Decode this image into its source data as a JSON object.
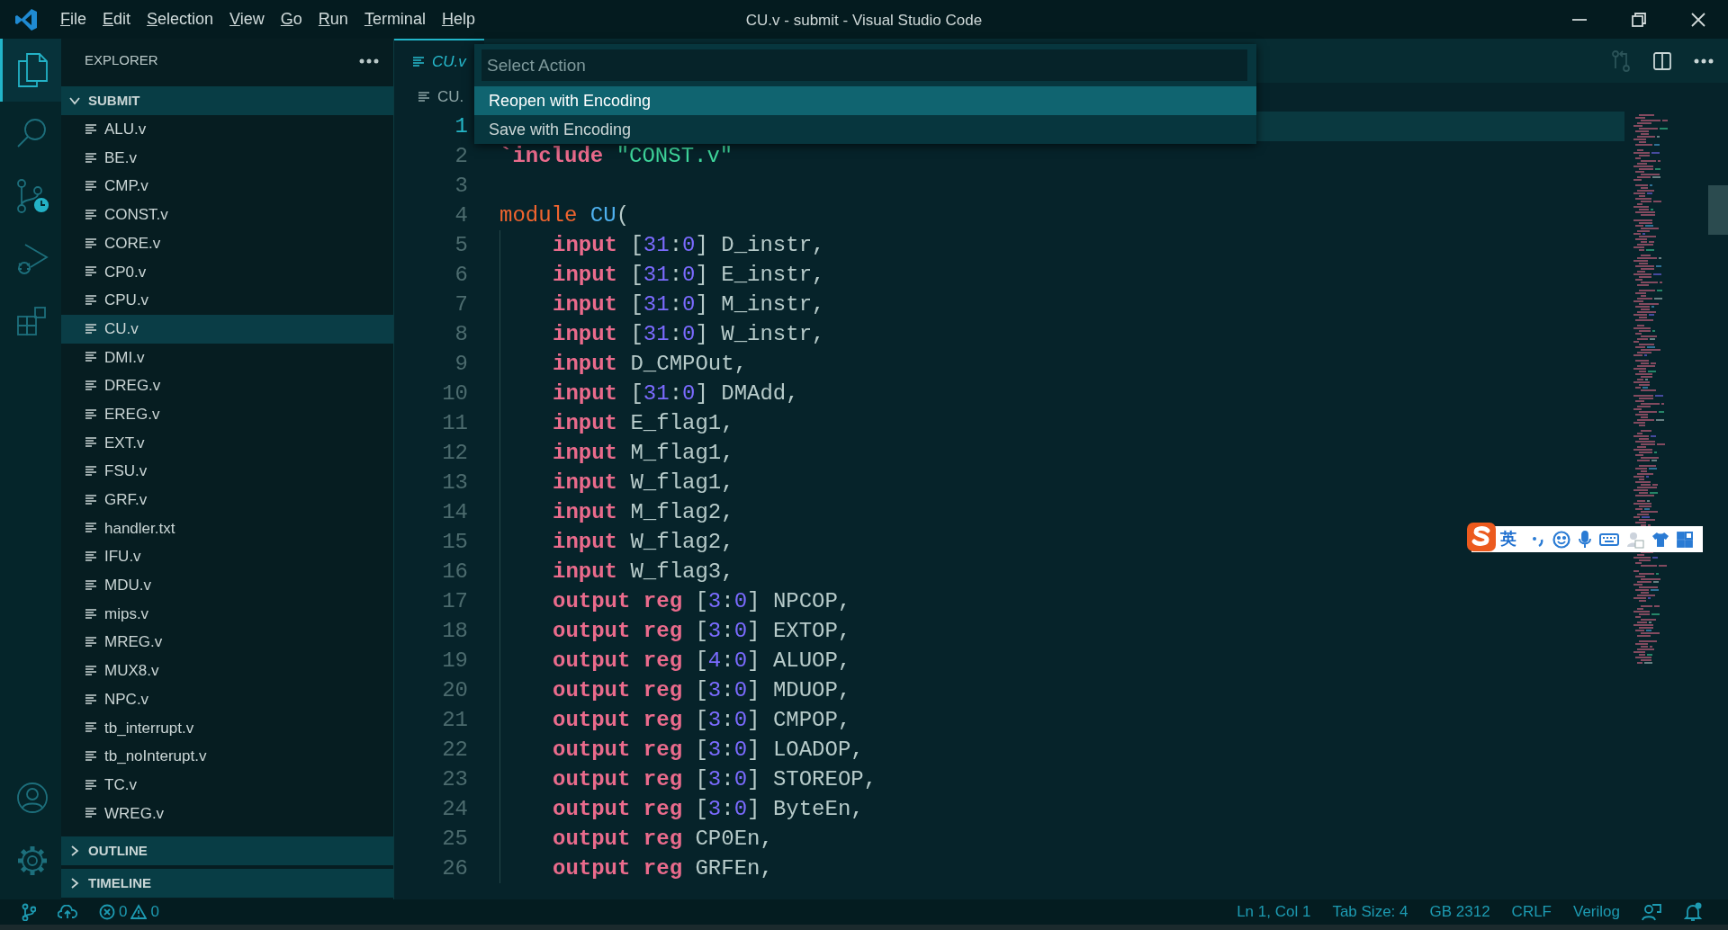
{
  "window": {
    "title": "CU.v - submit - Visual Studio Code"
  },
  "menu": [
    {
      "label": "File"
    },
    {
      "label": "Edit"
    },
    {
      "label": "Selection"
    },
    {
      "label": "View"
    },
    {
      "label": "Go"
    },
    {
      "label": "Run"
    },
    {
      "label": "Terminal"
    },
    {
      "label": "Help"
    }
  ],
  "activity_bar": [
    {
      "kind": "explorer",
      "selected": true
    },
    {
      "kind": "search",
      "selected": false
    },
    {
      "kind": "source-control",
      "selected": false
    },
    {
      "kind": "run",
      "selected": false
    },
    {
      "kind": "extensions",
      "selected": false
    }
  ],
  "activity_bar_bottom": [
    {
      "kind": "account"
    },
    {
      "kind": "settings"
    }
  ],
  "sidebar": {
    "title": "EXPLORER",
    "sections": [
      {
        "label": "SUBMIT",
        "expanded": true,
        "items": [
          {
            "label": "ALU.v",
            "selected": false
          },
          {
            "label": "BE.v",
            "selected": false
          },
          {
            "label": "CMP.v",
            "selected": false
          },
          {
            "label": "CONST.v",
            "selected": false
          },
          {
            "label": "CORE.v",
            "selected": false
          },
          {
            "label": "CP0.v",
            "selected": false
          },
          {
            "label": "CPU.v",
            "selected": false
          },
          {
            "label": "CU.v",
            "selected": true
          },
          {
            "label": "DMI.v",
            "selected": false
          },
          {
            "label": "DREG.v",
            "selected": false
          },
          {
            "label": "EREG.v",
            "selected": false
          },
          {
            "label": "EXT.v",
            "selected": false
          },
          {
            "label": "FSU.v",
            "selected": false
          },
          {
            "label": "GRF.v",
            "selected": false
          },
          {
            "label": "handler.txt",
            "selected": false
          },
          {
            "label": "IFU.v",
            "selected": false
          },
          {
            "label": "MDU.v",
            "selected": false
          },
          {
            "label": "mips.v",
            "selected": false
          },
          {
            "label": "MREG.v",
            "selected": false
          },
          {
            "label": "MUX8.v",
            "selected": false
          },
          {
            "label": "NPC.v",
            "selected": false
          },
          {
            "label": "tb_interrupt.v",
            "selected": false
          },
          {
            "label": "tb_noInterupt.v",
            "selected": false
          },
          {
            "label": "TC.v",
            "selected": false
          },
          {
            "label": "WREG.v",
            "selected": false
          }
        ]
      },
      {
        "label": "OUTLINE",
        "expanded": false
      },
      {
        "label": "TIMELINE",
        "expanded": false
      }
    ]
  },
  "editor": {
    "tabs": [
      {
        "label": "CU.v",
        "selected": true,
        "preview": true
      }
    ],
    "breadcrumb": "CU.",
    "lines": [
      {
        "n": "1",
        "current": true,
        "indented": false
      },
      {
        "n": "2",
        "current": false,
        "indented": false,
        "tokens": [
          {
            "kind": "keyword",
            "text": "`include"
          },
          {
            "kind": "string",
            "text": "\"CONST.v\"",
            "gap": true
          }
        ]
      },
      {
        "n": "3",
        "current": false,
        "indented": false
      },
      {
        "n": "4",
        "current": false,
        "indented": false,
        "tokens": [
          {
            "kind": "module",
            "text": "module"
          },
          {
            "kind": "name",
            "text": "CU",
            "gap": true
          },
          {
            "kind": "plain",
            "text": "("
          }
        ]
      },
      {
        "n": "5",
        "current": false,
        "indented": true,
        "tokens": [
          {
            "kind": "keyword",
            "text": "input"
          },
          {
            "kind": "plain",
            "text": "[",
            "gap": true
          },
          {
            "kind": "number",
            "text": "31"
          },
          {
            "kind": "plain",
            "text": ":"
          },
          {
            "kind": "number",
            "text": "0"
          },
          {
            "kind": "plain",
            "text": "] D_instr,"
          }
        ]
      },
      {
        "n": "6",
        "current": false,
        "indented": true,
        "tokens": [
          {
            "kind": "keyword",
            "text": "input"
          },
          {
            "kind": "plain",
            "text": "[",
            "gap": true
          },
          {
            "kind": "number",
            "text": "31"
          },
          {
            "kind": "plain",
            "text": ":"
          },
          {
            "kind": "number",
            "text": "0"
          },
          {
            "kind": "plain",
            "text": "] E_instr,"
          }
        ]
      },
      {
        "n": "7",
        "current": false,
        "indented": true,
        "tokens": [
          {
            "kind": "keyword",
            "text": "input"
          },
          {
            "kind": "plain",
            "text": "[",
            "gap": true
          },
          {
            "kind": "number",
            "text": "31"
          },
          {
            "kind": "plain",
            "text": ":"
          },
          {
            "kind": "number",
            "text": "0"
          },
          {
            "kind": "plain",
            "text": "] M_instr,"
          }
        ]
      },
      {
        "n": "8",
        "current": false,
        "indented": true,
        "tokens": [
          {
            "kind": "keyword",
            "text": "input"
          },
          {
            "kind": "plain",
            "text": "[",
            "gap": true
          },
          {
            "kind": "number",
            "text": "31"
          },
          {
            "kind": "plain",
            "text": ":"
          },
          {
            "kind": "number",
            "text": "0"
          },
          {
            "kind": "plain",
            "text": "] W_instr,"
          }
        ]
      },
      {
        "n": "9",
        "current": false,
        "indented": true,
        "tokens": [
          {
            "kind": "keyword",
            "text": "input"
          },
          {
            "kind": "plain",
            "text": "D_CMPOut,",
            "gap": true
          }
        ]
      },
      {
        "n": "10",
        "current": false,
        "indented": true,
        "tokens": [
          {
            "kind": "keyword",
            "text": "input"
          },
          {
            "kind": "plain",
            "text": "[",
            "gap": true
          },
          {
            "kind": "number",
            "text": "31"
          },
          {
            "kind": "plain",
            "text": ":"
          },
          {
            "kind": "number",
            "text": "0"
          },
          {
            "kind": "plain",
            "text": "] DMAdd,"
          }
        ]
      },
      {
        "n": "11",
        "current": false,
        "indented": true,
        "tokens": [
          {
            "kind": "keyword",
            "text": "input"
          },
          {
            "kind": "plain",
            "text": "E_flag1,",
            "gap": true
          }
        ]
      },
      {
        "n": "12",
        "current": false,
        "indented": true,
        "tokens": [
          {
            "kind": "keyword",
            "text": "input"
          },
          {
            "kind": "plain",
            "text": "M_flag1,",
            "gap": true
          }
        ]
      },
      {
        "n": "13",
        "current": false,
        "indented": true,
        "tokens": [
          {
            "kind": "keyword",
            "text": "input"
          },
          {
            "kind": "plain",
            "text": "W_flag1,",
            "gap": true
          }
        ]
      },
      {
        "n": "14",
        "current": false,
        "indented": true,
        "tokens": [
          {
            "kind": "keyword",
            "text": "input"
          },
          {
            "kind": "plain",
            "text": "M_flag2,",
            "gap": true
          }
        ]
      },
      {
        "n": "15",
        "current": false,
        "indented": true,
        "tokens": [
          {
            "kind": "keyword",
            "text": "input"
          },
          {
            "kind": "plain",
            "text": "W_flag2,",
            "gap": true
          }
        ]
      },
      {
        "n": "16",
        "current": false,
        "indented": true,
        "tokens": [
          {
            "kind": "keyword",
            "text": "input"
          },
          {
            "kind": "plain",
            "text": "W_flag3,",
            "gap": true
          }
        ]
      },
      {
        "n": "17",
        "current": false,
        "indented": true,
        "tokens": [
          {
            "kind": "keyword",
            "text": "output"
          },
          {
            "kind": "keyword",
            "text": "reg",
            "gap": true
          },
          {
            "kind": "plain",
            "text": "[",
            "gap": true
          },
          {
            "kind": "number",
            "text": "3"
          },
          {
            "kind": "plain",
            "text": ":"
          },
          {
            "kind": "number",
            "text": "0"
          },
          {
            "kind": "plain",
            "text": "] NPCOP,"
          }
        ]
      },
      {
        "n": "18",
        "current": false,
        "indented": true,
        "tokens": [
          {
            "kind": "keyword",
            "text": "output"
          },
          {
            "kind": "keyword",
            "text": "reg",
            "gap": true
          },
          {
            "kind": "plain",
            "text": "[",
            "gap": true
          },
          {
            "kind": "number",
            "text": "3"
          },
          {
            "kind": "plain",
            "text": ":"
          },
          {
            "kind": "number",
            "text": "0"
          },
          {
            "kind": "plain",
            "text": "] EXTOP,"
          }
        ]
      },
      {
        "n": "19",
        "current": false,
        "indented": true,
        "tokens": [
          {
            "kind": "keyword",
            "text": "output"
          },
          {
            "kind": "keyword",
            "text": "reg",
            "gap": true
          },
          {
            "kind": "plain",
            "text": "[",
            "gap": true
          },
          {
            "kind": "number",
            "text": "4"
          },
          {
            "kind": "plain",
            "text": ":"
          },
          {
            "kind": "number",
            "text": "0"
          },
          {
            "kind": "plain",
            "text": "] ALUOP,"
          }
        ]
      },
      {
        "n": "20",
        "current": false,
        "indented": true,
        "tokens": [
          {
            "kind": "keyword",
            "text": "output"
          },
          {
            "kind": "keyword",
            "text": "reg",
            "gap": true
          },
          {
            "kind": "plain",
            "text": "[",
            "gap": true
          },
          {
            "kind": "number",
            "text": "3"
          },
          {
            "kind": "plain",
            "text": ":"
          },
          {
            "kind": "number",
            "text": "0"
          },
          {
            "kind": "plain",
            "text": "] MDUOP,"
          }
        ]
      },
      {
        "n": "21",
        "current": false,
        "indented": true,
        "tokens": [
          {
            "kind": "keyword",
            "text": "output"
          },
          {
            "kind": "keyword",
            "text": "reg",
            "gap": true
          },
          {
            "kind": "plain",
            "text": "[",
            "gap": true
          },
          {
            "kind": "number",
            "text": "3"
          },
          {
            "kind": "plain",
            "text": ":"
          },
          {
            "kind": "number",
            "text": "0"
          },
          {
            "kind": "plain",
            "text": "] CMPOP,"
          }
        ]
      },
      {
        "n": "22",
        "current": false,
        "indented": true,
        "tokens": [
          {
            "kind": "keyword",
            "text": "output"
          },
          {
            "kind": "keyword",
            "text": "reg",
            "gap": true
          },
          {
            "kind": "plain",
            "text": "[",
            "gap": true
          },
          {
            "kind": "number",
            "text": "3"
          },
          {
            "kind": "plain",
            "text": ":"
          },
          {
            "kind": "number",
            "text": "0"
          },
          {
            "kind": "plain",
            "text": "] LOADOP,"
          }
        ]
      },
      {
        "n": "23",
        "current": false,
        "indented": true,
        "tokens": [
          {
            "kind": "keyword",
            "text": "output"
          },
          {
            "kind": "keyword",
            "text": "reg",
            "gap": true
          },
          {
            "kind": "plain",
            "text": "[",
            "gap": true
          },
          {
            "kind": "number",
            "text": "3"
          },
          {
            "kind": "plain",
            "text": ":"
          },
          {
            "kind": "number",
            "text": "0"
          },
          {
            "kind": "plain",
            "text": "] STOREOP,"
          }
        ]
      },
      {
        "n": "24",
        "current": false,
        "indented": true,
        "tokens": [
          {
            "kind": "keyword",
            "text": "output"
          },
          {
            "kind": "keyword",
            "text": "reg",
            "gap": true
          },
          {
            "kind": "plain",
            "text": "[",
            "gap": true
          },
          {
            "kind": "number",
            "text": "3"
          },
          {
            "kind": "plain",
            "text": ":"
          },
          {
            "kind": "number",
            "text": "0"
          },
          {
            "kind": "plain",
            "text": "] ByteEn,"
          }
        ]
      },
      {
        "n": "25",
        "current": false,
        "indented": true,
        "tokens": [
          {
            "kind": "keyword",
            "text": "output"
          },
          {
            "kind": "keyword",
            "text": "reg",
            "gap": true
          },
          {
            "kind": "plain",
            "text": "CP0En,",
            "gap": true
          }
        ]
      },
      {
        "n": "26",
        "current": false,
        "indented": true,
        "tokens": [
          {
            "kind": "keyword",
            "text": "output"
          },
          {
            "kind": "keyword",
            "text": "reg",
            "gap": true
          },
          {
            "kind": "plain",
            "text": "GRFEn,",
            "gap": true
          }
        ]
      }
    ]
  },
  "quick_pick": {
    "placeholder": "Select Action",
    "items": [
      {
        "label": "Reopen with Encoding",
        "selected": true
      },
      {
        "label": "Save with Encoding",
        "selected": false
      }
    ]
  },
  "ime_toolbar": {
    "mode": "英"
  },
  "status_bar": {
    "errors": "0",
    "warnings": "0",
    "items": [
      "Ln 1, Col 1",
      "Tab Size: 4",
      "GB 2312",
      "CRLF",
      "Verilog"
    ]
  }
}
